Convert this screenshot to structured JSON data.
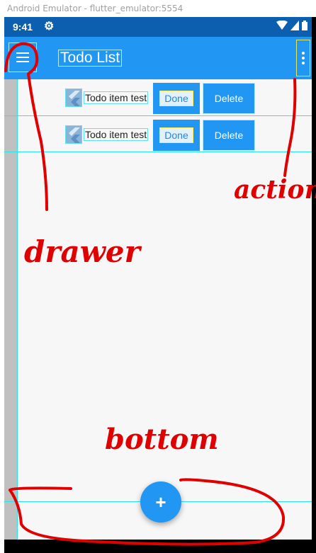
{
  "window": {
    "title": "Android Emulator - flutter_emulator:5554"
  },
  "status_bar": {
    "time": "9:41",
    "settings_icon": "gear-icon",
    "wifi_icon": "wifi-icon",
    "signal_icon": "signal-icon",
    "battery_icon": "battery-icon"
  },
  "app_bar": {
    "title": "Todo List",
    "leading_icon": "menu-icon",
    "action_icon": "more-vert-icon",
    "color": "#2196f3"
  },
  "todos": [
    {
      "label": "Todo item test",
      "done_label": "Done",
      "delete_label": "Delete"
    },
    {
      "label": "Todo item test",
      "done_label": "Done",
      "delete_label": "Delete"
    }
  ],
  "fab": {
    "icon": "add-icon",
    "glyph": "+"
  },
  "annotations": {
    "drawer": "drawer",
    "action": "action",
    "bottom": "bottom",
    "color": "#e00000"
  }
}
